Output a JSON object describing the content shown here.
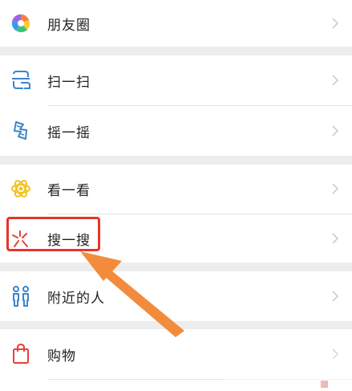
{
  "menu": {
    "items": [
      {
        "label": "朋友圈",
        "icon": "moments-icon"
      },
      {
        "label": "扫一扫",
        "icon": "scan-icon"
      },
      {
        "label": "摇一摇",
        "icon": "shake-icon"
      },
      {
        "label": "看一看",
        "icon": "top-stories-icon"
      },
      {
        "label": "搜一搜",
        "icon": "search-icon"
      },
      {
        "label": "附近的人",
        "icon": "people-nearby-icon"
      },
      {
        "label": "购物",
        "icon": "shopping-bag-icon"
      }
    ],
    "highlighted_item": "搜一搜"
  },
  "colors": {
    "background": "#ededed",
    "card": "#ffffff",
    "highlight_box": "#e8332b",
    "arrow": "#f28c3c",
    "chevron": "#c8c8c8"
  }
}
